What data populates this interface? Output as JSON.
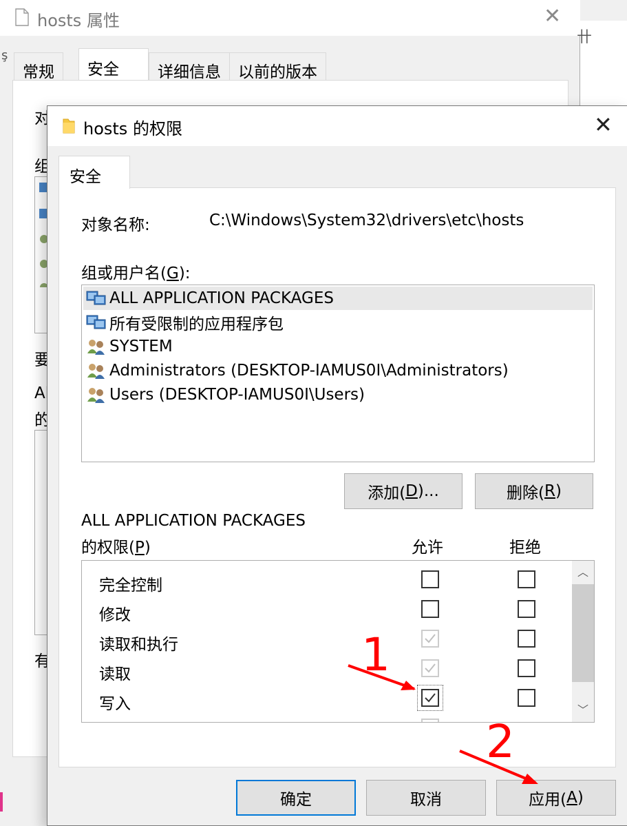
{
  "props_window": {
    "title": "hosts 属性",
    "tabs": [
      {
        "label": "常规"
      },
      {
        "label": "安全",
        "active": true
      },
      {
        "label": "详细信息"
      },
      {
        "label": "以前的版本"
      }
    ],
    "peek_fragments": [
      "对",
      "组",
      "要",
      "Al",
      "的",
      "有",
      "ş",
      "卄"
    ]
  },
  "perm_window": {
    "title": "hosts 的权限",
    "tab": "安全",
    "object_name_label": "对象名称:",
    "object_name_value": "C:\\Windows\\System32\\drivers\\etc\\hosts",
    "group_label_pre": "组或用户名(",
    "group_label_key": "G",
    "group_label_post": "):",
    "groups": [
      {
        "name": "ALL APPLICATION PACKAGES",
        "icon": "app-package-group-icon",
        "selected": true
      },
      {
        "name": "所有受限制的应用程序包",
        "icon": "app-package-group-icon",
        "selected": false
      },
      {
        "name": "SYSTEM",
        "icon": "user-group-icon",
        "selected": false
      },
      {
        "name": "Administrators (DESKTOP-IAMUS0I\\Administrators)",
        "icon": "user-group-icon",
        "selected": false
      },
      {
        "name": "Users (DESKTOP-IAMUS0I\\Users)",
        "icon": "user-group-icon",
        "selected": false
      }
    ],
    "add_pre": "添加(",
    "add_key": "D",
    "add_post": ")...",
    "remove_pre": "删除(",
    "remove_key": "R",
    "remove_post": ")",
    "perm_for_line1": "ALL APPLICATION PACKAGES",
    "perm_for_pre": "的权限(",
    "perm_for_key": "P",
    "perm_for_post": ")",
    "allow_header": "允许",
    "deny_header": "拒绝",
    "permissions": [
      {
        "name": "完全控制",
        "allow": false,
        "allow_disabled": false,
        "deny": false
      },
      {
        "name": "修改",
        "allow": false,
        "allow_disabled": false,
        "deny": false
      },
      {
        "name": "读取和执行",
        "allow": true,
        "allow_disabled": true,
        "deny": false
      },
      {
        "name": "读取",
        "allow": true,
        "allow_disabled": true,
        "deny": false
      },
      {
        "name": "写入",
        "allow": true,
        "allow_disabled": false,
        "deny": false,
        "focused": true
      }
    ],
    "ok_label": "确定",
    "cancel_label": "取消",
    "apply_pre": "应用(",
    "apply_key": "A",
    "apply_post": ")"
  },
  "annotations": {
    "step1": "1",
    "step2": "2",
    "color": "#ff0000"
  }
}
